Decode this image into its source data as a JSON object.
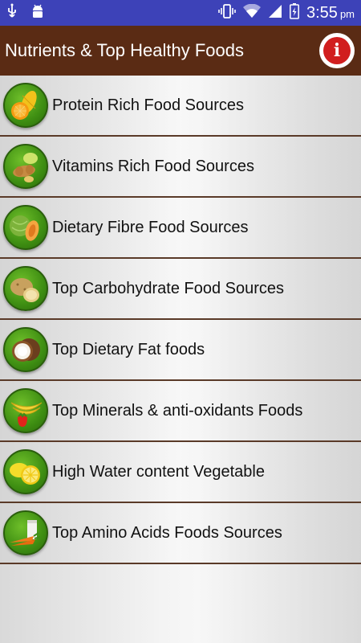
{
  "status_bar": {
    "time": "3:55",
    "ampm": "pm",
    "icons": [
      "usb-icon",
      "android-icon",
      "vibrate-icon",
      "wifi-icon",
      "signal-icon",
      "battery-icon"
    ]
  },
  "app_bar": {
    "title": "Nutrients & Top Healthy Foods",
    "info_glyph": "i"
  },
  "colors": {
    "status_bar": "#3d42b8",
    "app_bar": "#5a2b14",
    "icon_green": "#3e8e12",
    "info_red": "#d11e1e"
  },
  "items": [
    {
      "label": "Protein Rich Food Sources",
      "icon": "corn-orange-icon"
    },
    {
      "label": "Vitamins Rich Food Sources",
      "icon": "peanut-lemon-icon"
    },
    {
      "label": "Dietary Fibre Food Sources",
      "icon": "cabbage-papaya-icon"
    },
    {
      "label": "Top Carbohydrate Food Sources",
      "icon": "potato-icon"
    },
    {
      "label": "Top Dietary Fat foods",
      "icon": "coconut-icon"
    },
    {
      "label": "Top Minerals & anti-oxidants Foods",
      "icon": "banana-strawberry-icon"
    },
    {
      "label": "High Water content Vegetable",
      "icon": "lemon-icon"
    },
    {
      "label": "Top Amino Acids Foods Sources",
      "icon": "carrot-milk-icon"
    }
  ]
}
